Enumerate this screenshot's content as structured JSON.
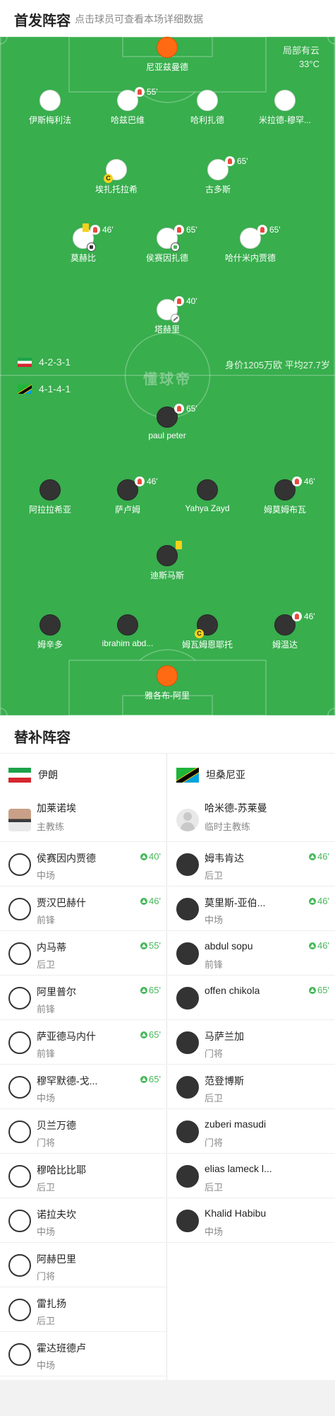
{
  "header": {
    "title": "首发阵容",
    "hint": "点击球员可查看本场详细数据"
  },
  "weather": {
    "condition": "局部有云",
    "temperature": "33°C"
  },
  "watermark": "懂球帝",
  "home": {
    "formation": "4-2-3-1",
    "flag": "iran-flag",
    "players": [
      {
        "name": "尼亚兹曼德",
        "kit": "gk-home"
      },
      {
        "name": "伊斯梅利法",
        "kit": "white"
      },
      {
        "name": "哈兹巴维",
        "kit": "white",
        "sub": "55'"
      },
      {
        "name": "哈利扎德",
        "kit": "white"
      },
      {
        "name": "米拉德-穆罕...",
        "kit": "white"
      },
      {
        "name": "埃扎托拉希",
        "kit": "white",
        "captain": "C"
      },
      {
        "name": "古多斯",
        "kit": "white",
        "sub": "65'"
      },
      {
        "name": "莫赫比",
        "kit": "white",
        "sub": "46'",
        "yellow": true,
        "goal": true
      },
      {
        "name": "侯赛因扎德",
        "kit": "white",
        "sub": "65'",
        "goal_green": true
      },
      {
        "name": "哈什米内贾德",
        "kit": "white",
        "sub": "65'"
      },
      {
        "name": "塔赫里",
        "kit": "white",
        "sub": "40'",
        "assist": true
      }
    ]
  },
  "away": {
    "formation": "4-1-4-1",
    "flag": "tanzania-flag",
    "value_info": "身价1205万欧 平均27.7岁",
    "players": [
      {
        "name": "paul peter",
        "kit": "dark",
        "sub": "65'"
      },
      {
        "name": "阿拉拉希亚",
        "kit": "dark"
      },
      {
        "name": "萨卢姆",
        "kit": "dark",
        "sub": "46'"
      },
      {
        "name": "Yahya Zayd",
        "kit": "dark"
      },
      {
        "name": "姆莫姆布瓦",
        "kit": "dark",
        "sub": "46'"
      },
      {
        "name": "迪斯马斯",
        "kit": "dark",
        "yellow": true
      },
      {
        "name": "姆辛多",
        "kit": "dark"
      },
      {
        "name": "ibrahim abd...",
        "kit": "dark"
      },
      {
        "name": "姆瓦姆恩耶托",
        "kit": "dark",
        "captain": "C"
      },
      {
        "name": "姆温达",
        "kit": "dark",
        "sub": "46'"
      },
      {
        "name": "雅各布-阿里",
        "kit": "gk-away"
      }
    ]
  },
  "subs_header": {
    "title": "替补阵容"
  },
  "subs": {
    "home": {
      "team": "伊朗",
      "coach": {
        "name": "加莱诺埃",
        "role": "主教练"
      },
      "players": [
        {
          "name": "侯赛因内贾德",
          "pos": "中场",
          "in": "40'"
        },
        {
          "name": "贾汉巴赫什",
          "pos": "前锋",
          "in": "46'"
        },
        {
          "name": "内马蒂",
          "pos": "后卫",
          "in": "55'"
        },
        {
          "name": "阿里普尔",
          "pos": "前锋",
          "in": "65'"
        },
        {
          "name": "萨亚德马内什",
          "pos": "前锋",
          "in": "65'"
        },
        {
          "name": "穆罕默德-戈...",
          "pos": "中场",
          "in": "65'"
        },
        {
          "name": "贝兰万德",
          "pos": "门将"
        },
        {
          "name": "穆哈比比耶",
          "pos": "后卫"
        },
        {
          "name": "诺拉夫坎",
          "pos": "中场"
        },
        {
          "name": "阿赫巴里",
          "pos": "门将"
        },
        {
          "name": "雷扎扬",
          "pos": "后卫"
        },
        {
          "name": "霍达班德卢",
          "pos": "中场"
        }
      ]
    },
    "away": {
      "team": "坦桑尼亚",
      "coach": {
        "name": "哈米德-苏莱曼",
        "role": "临时主教练"
      },
      "players": [
        {
          "name": "姆韦肯达",
          "pos": "后卫",
          "in": "46'"
        },
        {
          "name": "莫里斯-亚伯...",
          "pos": "中场",
          "in": "46'"
        },
        {
          "name": "abdul sopu",
          "pos": "前锋",
          "in": "46'"
        },
        {
          "name": "offen chikola",
          "pos": "",
          "in": "65'"
        },
        {
          "name": "马萨兰加",
          "pos": "门将"
        },
        {
          "name": "范登博斯",
          "pos": "后卫"
        },
        {
          "name": "zuberi masudi",
          "pos": "门将"
        },
        {
          "name": "elias lameck l...",
          "pos": "后卫"
        },
        {
          "name": "Khalid Habibu",
          "pos": "中场"
        }
      ]
    }
  }
}
